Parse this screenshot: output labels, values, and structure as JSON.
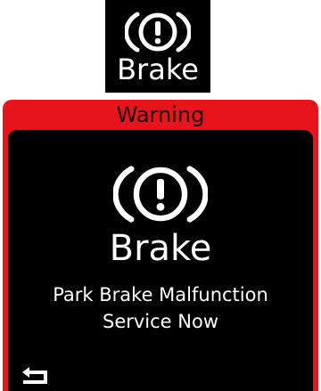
{
  "telltale": {
    "icon": "brake-warning-icon",
    "label": "Brake"
  },
  "popup": {
    "header_title": "Warning",
    "icon": "brake-warning-icon",
    "label": "Brake",
    "message_lines": [
      "Park Brake Malfunction",
      "Service Now"
    ],
    "back_icon": "back-arrow-icon"
  },
  "colors": {
    "header_red": "#e8141c",
    "panel_black": "#000000",
    "text_white": "#ffffff"
  }
}
